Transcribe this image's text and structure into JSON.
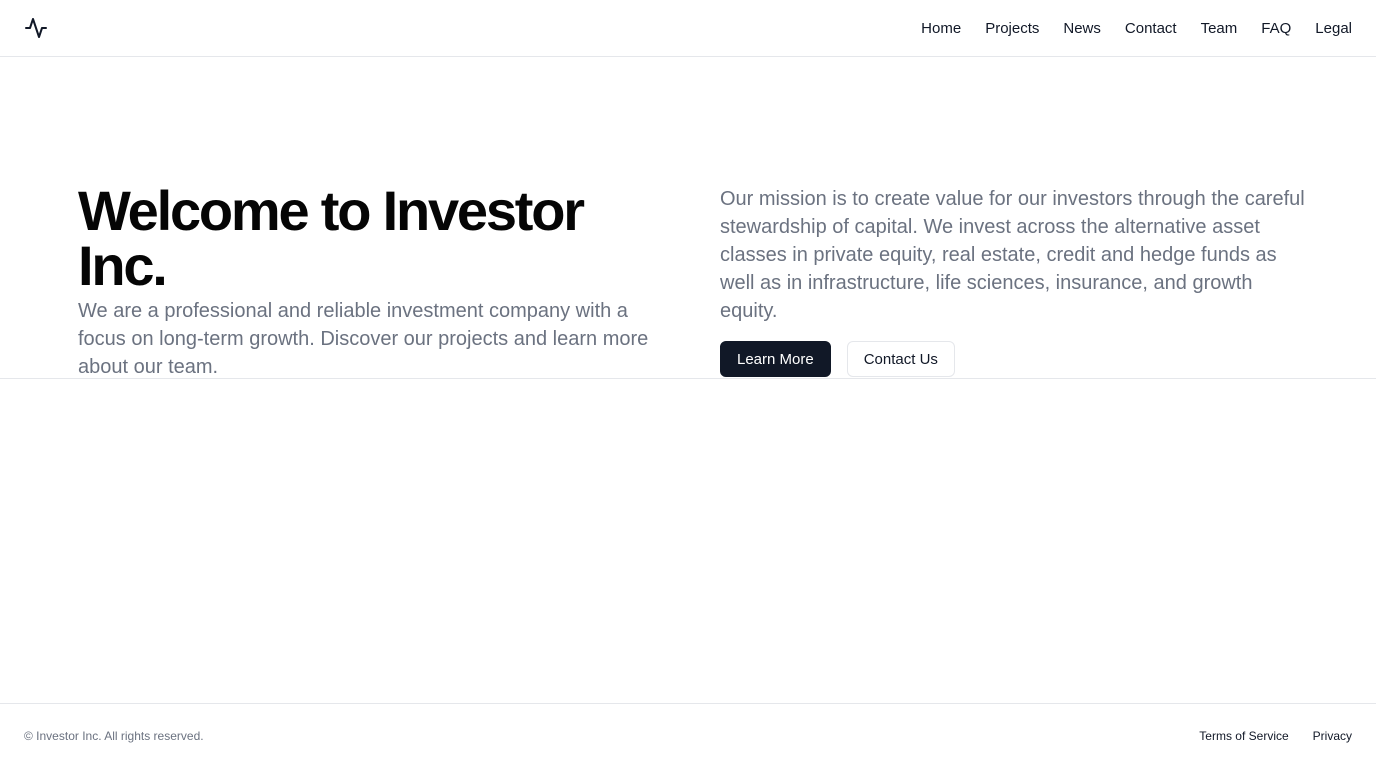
{
  "header": {
    "logo_icon": "activity-pulse-icon",
    "nav": [
      "Home",
      "Projects",
      "News",
      "Contact",
      "Team",
      "FAQ",
      "Legal"
    ]
  },
  "hero": {
    "title": "Welcome to Investor Inc.",
    "subtitle": "We are a professional and reliable investment company with a focus on long-term growth. Discover our projects and learn more about our team.",
    "mission": "Our mission is to create value for our investors through the careful stewardship of capital. We invest across the alternative asset classes in private equity, real estate, credit and hedge funds as well as in infrastructure, life sciences, insurance, and growth equity.",
    "primary_button": "Learn More",
    "secondary_button": "Contact Us"
  },
  "footer": {
    "copyright": "© Investor Inc. All rights reserved.",
    "links": [
      "Terms of Service",
      "Privacy"
    ]
  },
  "colors": {
    "primary_button_bg": "#111827",
    "muted_text": "#6b7280",
    "border": "#e5e7eb"
  }
}
